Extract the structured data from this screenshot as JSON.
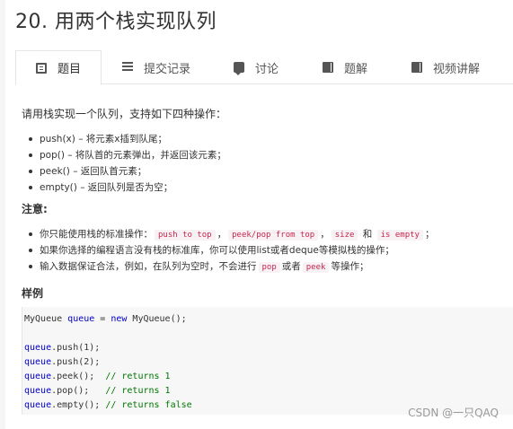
{
  "title": "20. 用两个栈实现队列",
  "tabs": [
    {
      "label": "题目",
      "icon": "document-icon",
      "active": true
    },
    {
      "label": "提交记录",
      "icon": "list-icon",
      "active": false
    },
    {
      "label": "讨论",
      "icon": "chat-icon",
      "active": false
    },
    {
      "label": "题解",
      "icon": "book-icon",
      "active": false
    },
    {
      "label": "视频讲解",
      "icon": "video-book-icon",
      "active": false
    }
  ],
  "intro": "请用栈实现一个队列，支持如下四种操作：",
  "operations": [
    "push(x) – 将元素x插到队尾；",
    "pop() – 将队首的元素弹出，并返回该元素；",
    "peek() – 返回队首元素；",
    "empty() – 返回队列是否为空；"
  ],
  "note_heading": "注意:",
  "notes": {
    "n1_prefix": "你只能使用栈的标准操作：",
    "n1_code1": "push to top",
    "n1_sep1": "，",
    "n1_code2": "peek/pop from top",
    "n1_sep2": "，",
    "n1_code3": "size",
    "n1_and": "和",
    "n1_code4": "is empty",
    "n1_suffix": "；",
    "n2": "如果你选择的编程语言没有栈的标准库，你可以使用list或者deque等模拟栈的操作；",
    "n3_prefix": "输入数据保证合法，例如，在队列为空时，不会进行",
    "n3_code1": "pop",
    "n3_mid": "或者",
    "n3_code2": "peek",
    "n3_suffix": "等操作；"
  },
  "example_heading": "样例",
  "code": {
    "l1a": "MyQueue ",
    "l1b": "queue",
    "l1c": " = ",
    "l1d": "new",
    "l1e": " MyQueue();",
    "l3a": "queue",
    "l3b": ".push(1);",
    "l4a": "queue",
    "l4b": ".push(2);",
    "l5a": "queue",
    "l5b": ".peek();  ",
    "l5c": "// returns 1",
    "l6a": "queue",
    "l6b": ".pop();   ",
    "l6c": "// returns 1",
    "l7a": "queue",
    "l7b": ".empty(); ",
    "l7c": "// returns false"
  },
  "watermark": "CSDN @一只QAQ"
}
